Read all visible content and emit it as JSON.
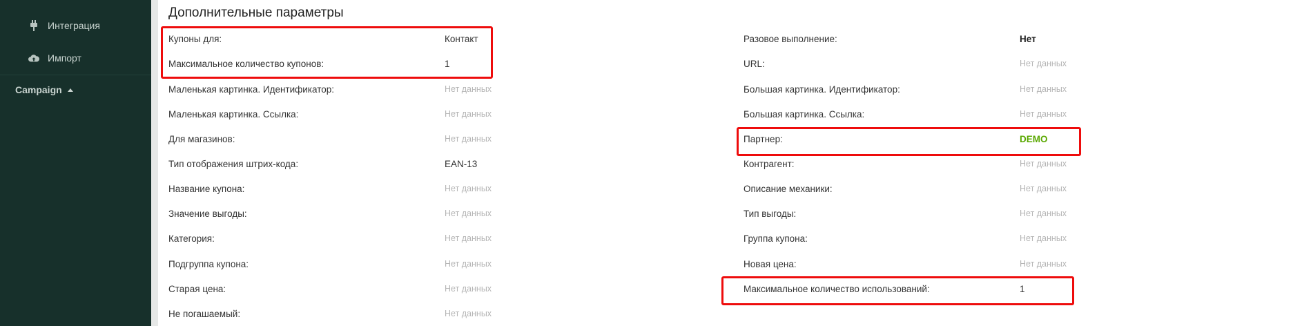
{
  "sidebar": {
    "items": [
      {
        "label": "Интеграция",
        "icon": "plug-icon"
      },
      {
        "label": "Импорт",
        "icon": "cloud-upload-icon"
      }
    ],
    "group": {
      "label": "Campaign",
      "icon": "caret-up-icon"
    }
  },
  "section": {
    "title": "Дополнительные параметры"
  },
  "left_fields": [
    {
      "label": "Купоны для:",
      "value": "Контакт"
    },
    {
      "label": "Максимальное количество купонов:",
      "value": "1"
    },
    {
      "label": "Маленькая картинка. Идентификатор:",
      "value": "Нет данных"
    },
    {
      "label": "Маленькая картинка. Ссылка:",
      "value": "Нет данных"
    },
    {
      "label": "Для магазинов:",
      "value": "Нет данных"
    },
    {
      "label": "Тип отображения штрих-кода:",
      "value": "EAN-13"
    },
    {
      "label": "Название купона:",
      "value": "Нет данных"
    },
    {
      "label": "Значение выгоды:",
      "value": "Нет данных"
    },
    {
      "label": "Категория:",
      "value": "Нет данных"
    },
    {
      "label": "Подгруппа купона:",
      "value": "Нет данных"
    },
    {
      "label": "Старая цена:",
      "value": "Нет данных"
    },
    {
      "label": "Не погашаемый:",
      "value": "Нет данных"
    }
  ],
  "right_fields": [
    {
      "label": "Разовое выполнение:",
      "value": "Нет"
    },
    {
      "label": "URL:",
      "value": "Нет данных"
    },
    {
      "label": "Большая картинка. Идентификатор:",
      "value": "Нет данных"
    },
    {
      "label": "Большая картинка. Ссылка:",
      "value": "Нет данных"
    },
    {
      "label": "Партнер:",
      "value": "DEMO"
    },
    {
      "label": "Контрагент:",
      "value": "Нет данных"
    },
    {
      "label": "Описание механики:",
      "value": "Нет данных"
    },
    {
      "label": "Тип выгоды:",
      "value": "Нет данных"
    },
    {
      "label": "Группа купона:",
      "value": "Нет данных"
    },
    {
      "label": "Новая цена:",
      "value": "Нет данных"
    },
    {
      "label": "Максимальное количество использований:",
      "value": "1"
    }
  ],
  "colors": {
    "sidebar_bg": "#17302b",
    "highlight": "#ee0c0c",
    "partner_value": "#5aa800",
    "empty_value": "#b5b5b5"
  }
}
